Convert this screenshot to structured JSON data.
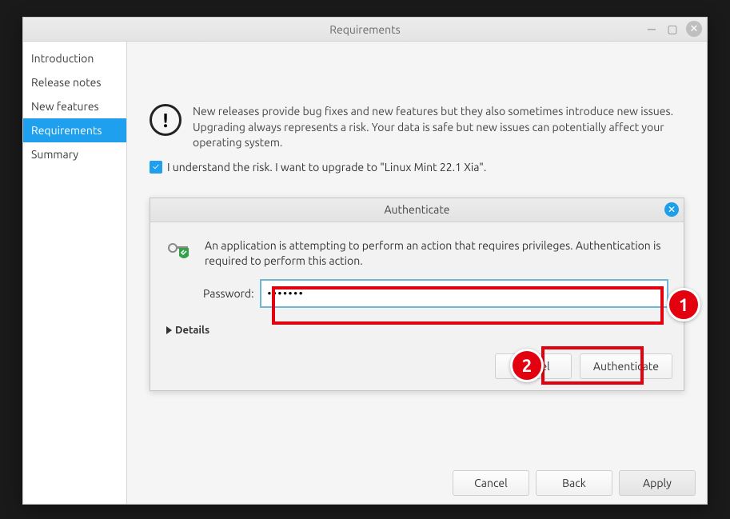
{
  "window": {
    "title": "Requirements"
  },
  "sidebar": {
    "items": [
      {
        "label": "Introduction"
      },
      {
        "label": "Release notes"
      },
      {
        "label": "New features"
      },
      {
        "label": "Requirements"
      },
      {
        "label": "Summary"
      }
    ],
    "active_index": 3
  },
  "info": {
    "text": "New releases provide bug fixes and new features but they also sometimes introduce new issues. Upgrading always represents a risk. Your data is safe but new issues can potentially affect your operating system."
  },
  "risk": {
    "checked": true,
    "label": "I understand the risk. I want to upgrade to \"Linux Mint 22.1 Xia\"."
  },
  "auth": {
    "title": "Authenticate",
    "message": "An application is attempting to perform an action that requires privileges. Authentication is required to perform this action.",
    "password_label": "Password:",
    "password_value": "•••••••",
    "details_label": "Details",
    "cancel_label": "Cancel",
    "authenticate_label": "Authenticate"
  },
  "footer": {
    "cancel": "Cancel",
    "back": "Back",
    "apply": "Apply"
  },
  "annotations": {
    "badge1": "1",
    "badge2": "2"
  }
}
